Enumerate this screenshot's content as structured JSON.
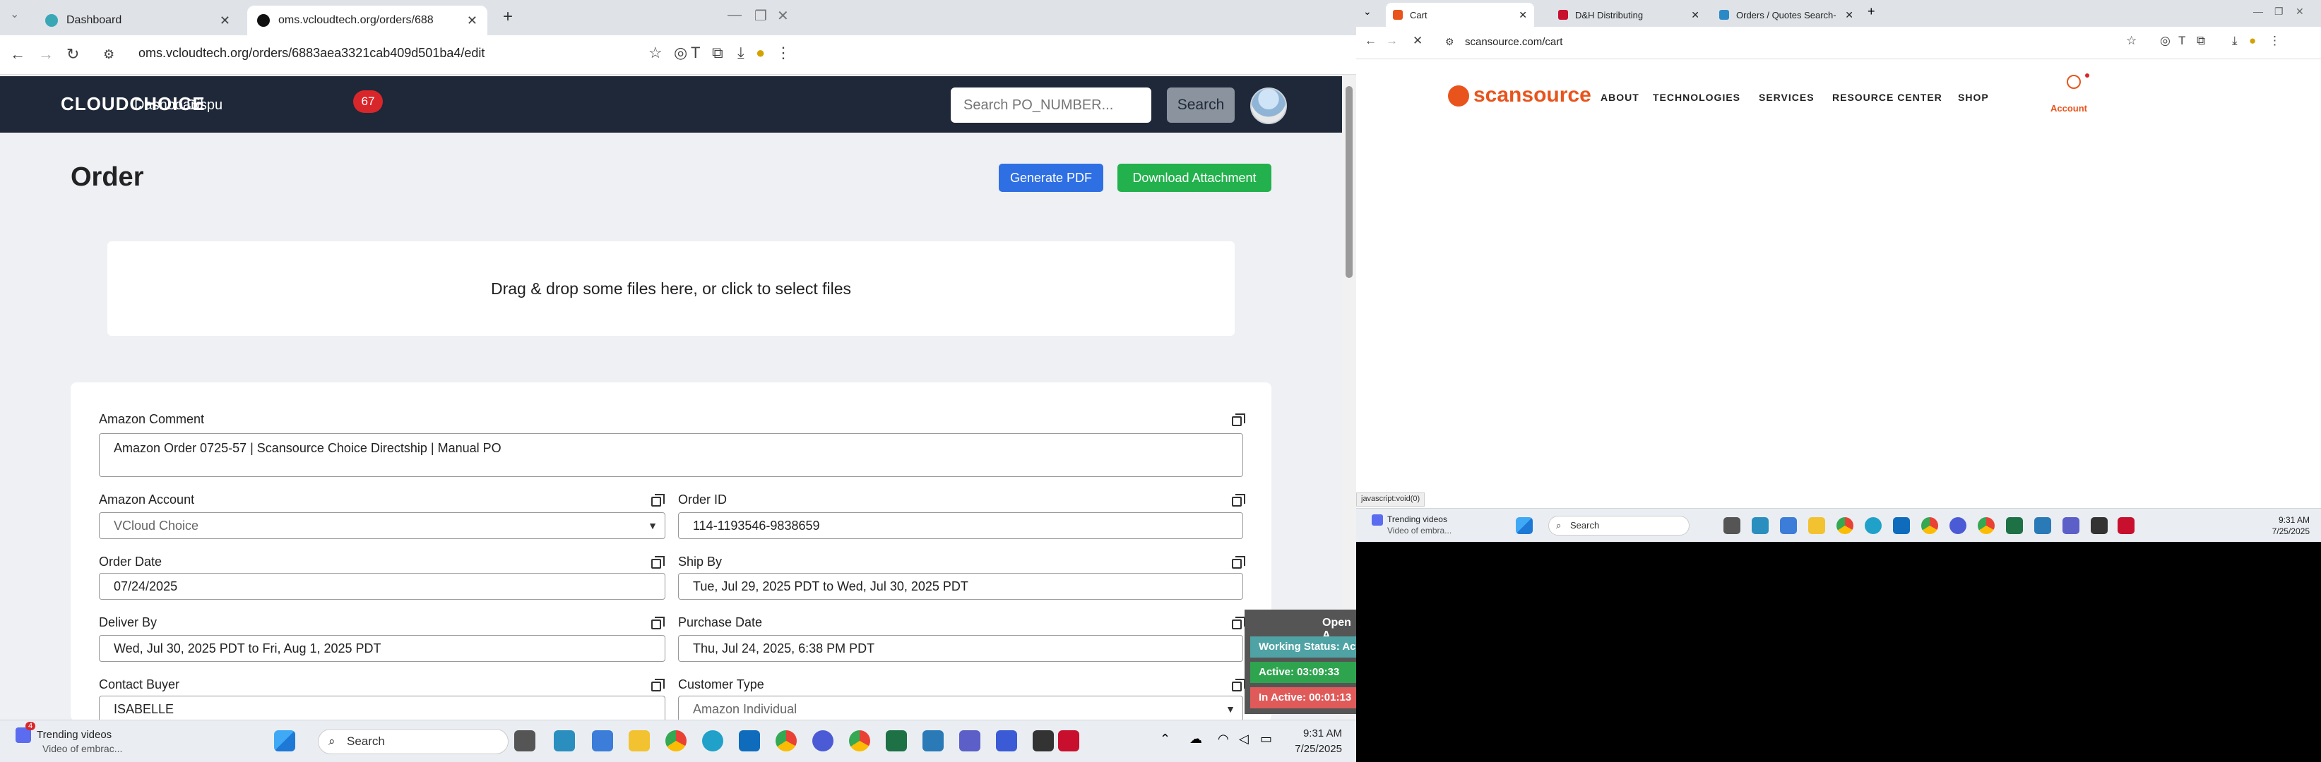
{
  "left_browser": {
    "tabs": [
      {
        "title": "Dashboard"
      },
      {
        "title": "oms.vcloudtech.org/orders/688"
      }
    ],
    "url": "oms.vcloudtech.org/orders/6883aea3321cab409d501ba4/edit"
  },
  "app": {
    "logo": "CLOUDCHOICE",
    "nav": {
      "dashboard": "Dashboard",
      "disputes": "Dispu",
      "disputes_count": "67"
    },
    "search": {
      "placeholder": "Search PO_NUMBER...",
      "button": "Search"
    }
  },
  "order": {
    "title": "Order",
    "generate_pdf": "Generate PDF",
    "download_attachment": "Download Attachment",
    "dropzone": "Drag & drop some files here, or click to select files",
    "fields": {
      "amazon_comment": {
        "label": "Amazon Comment",
        "value": "Amazon Order 0725-57 | Scansource Choice Directship | Manual PO"
      },
      "amazon_account": {
        "label": "Amazon Account",
        "value": "VCloud Choice"
      },
      "order_id": {
        "label": "Order ID",
        "value": "114-1193546-9838659"
      },
      "order_date": {
        "label": "Order Date",
        "value": "07/24/2025"
      },
      "ship_by": {
        "label": "Ship By",
        "value": "Tue, Jul 29, 2025 PDT to Wed, Jul 30, 2025 PDT"
      },
      "deliver_by": {
        "label": "Deliver By",
        "value": "Wed, Jul 30, 2025 PDT to Fri, Aug 1, 2025 PDT"
      },
      "purchase_date": {
        "label": "Purchase Date",
        "value": "Thu, Jul 24, 2025, 6:38 PM PDT"
      },
      "contact_buyer": {
        "label": "Contact Buyer",
        "value": "ISABELLE"
      },
      "customer_type": {
        "label": "Customer Type",
        "value": "Amazon Individual"
      }
    }
  },
  "status_overlay": {
    "header": "Open A",
    "working_status": "Working Status: Act",
    "active": "Active: 03:09:33",
    "inactive": "In Active: 00:01:13"
  },
  "left_taskbar": {
    "trending_title": "Trending videos",
    "trending_sub": "Video of embrac...",
    "trending_badge": "4",
    "search": "Search",
    "time": "9:31 AM",
    "date": "7/25/2025"
  },
  "right_browser": {
    "tabs": [
      {
        "title": "Cart"
      },
      {
        "title": "D&H Distributing"
      },
      {
        "title": "Orders / Quotes Search- ECExp"
      }
    ],
    "url": "scansource.com/cart",
    "status_text": "javascript:void(0)"
  },
  "scansource": {
    "logo": "scansource",
    "nav": [
      "ABOUT",
      "TECHNOLOGIES",
      "SERVICES",
      "RESOURCE CENTER",
      "SHOP"
    ],
    "account": "Account"
  },
  "right_taskbar": {
    "trending_title": "Trending videos",
    "trending_sub": "Video of embra...",
    "search": "Search",
    "time": "9:31 AM",
    "date": "7/25/2025"
  },
  "colors": {
    "navbar": "#1e2838",
    "primary_button": "#2f6fe4",
    "success_button": "#22b14c",
    "badge": "#d9262b",
    "scansource_brand": "#e8541c",
    "working_status": "#4fa3a5",
    "active": "#2ea44f",
    "inactive": "#e05a5a"
  }
}
